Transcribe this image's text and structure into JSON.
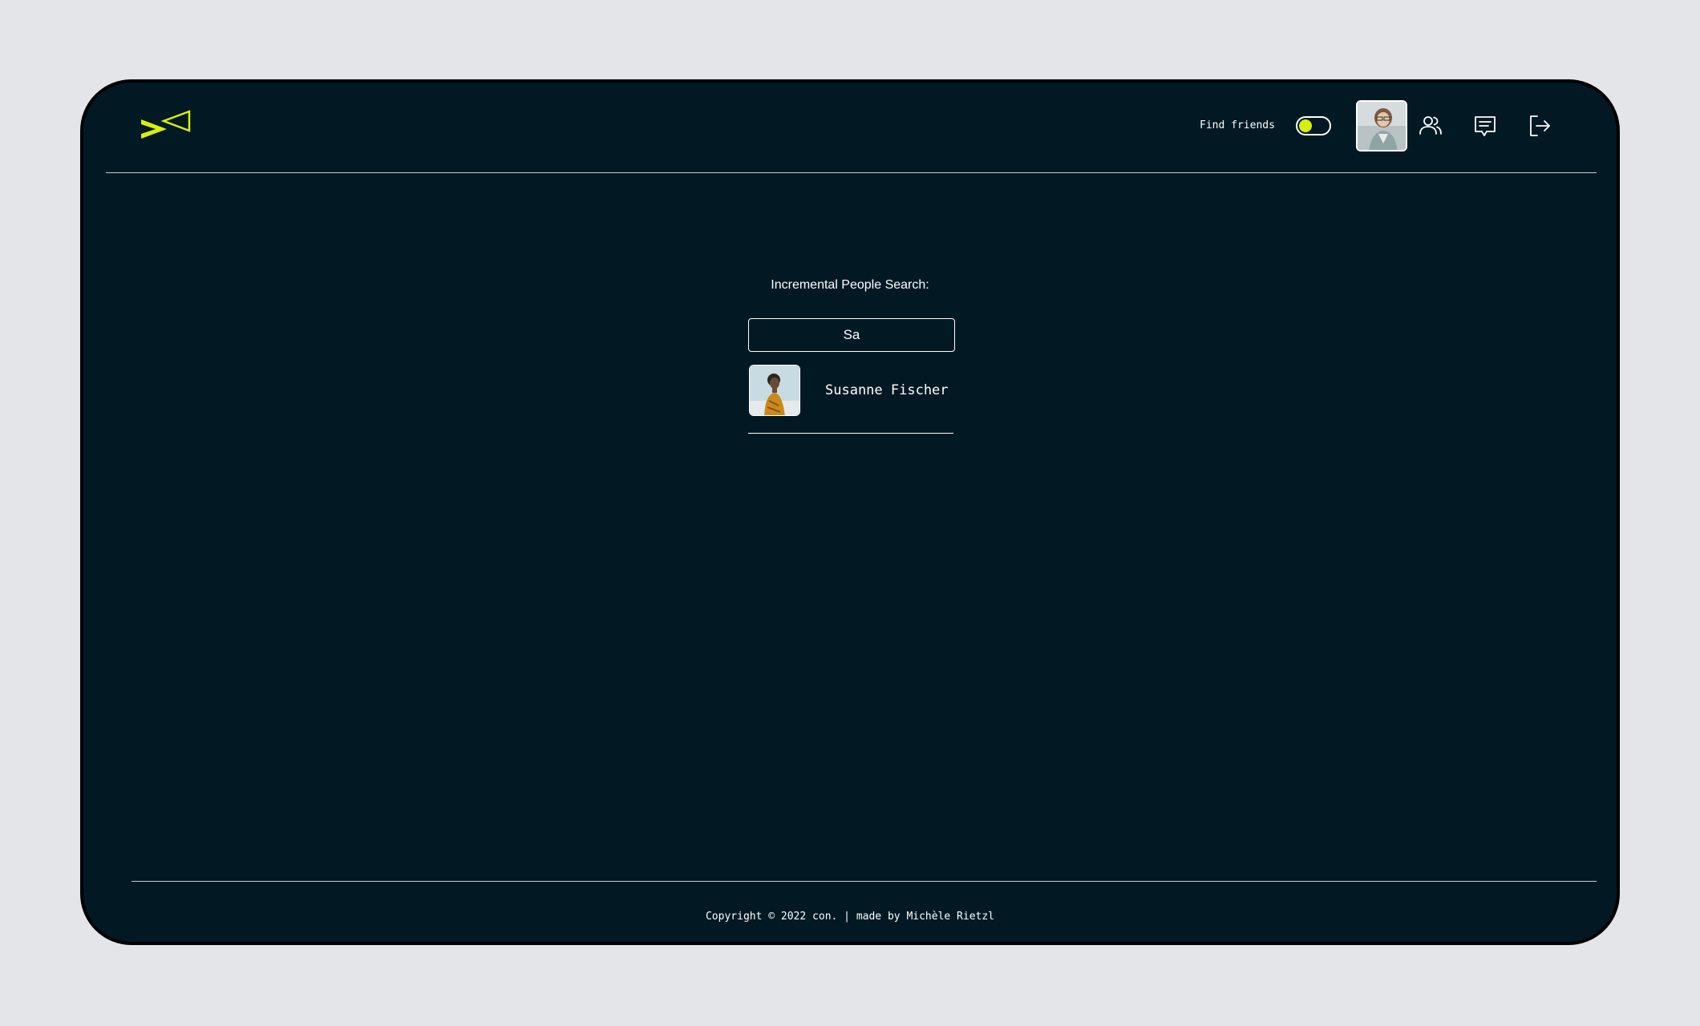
{
  "app": {
    "logo_icon": "cross-arrows-logo-icon",
    "accent_color": "#d7f00a",
    "background_color": "#021924"
  },
  "header": {
    "find_friends_label": "Find friends",
    "find_friends_toggle_on": true,
    "profile_avatar": "profile-photo-woman-glasses",
    "nav_icons": [
      "users-icon",
      "message-icon",
      "logout-icon"
    ]
  },
  "search": {
    "title": "Incremental People Search:",
    "query": "Sa",
    "results": [
      {
        "name": "Susanne Fischer",
        "avatar": "profile-photo-woman-yellow-top"
      }
    ]
  },
  "footer": {
    "copyright": "Copyright © 2022 con. | made by Michèle Rietzl"
  }
}
